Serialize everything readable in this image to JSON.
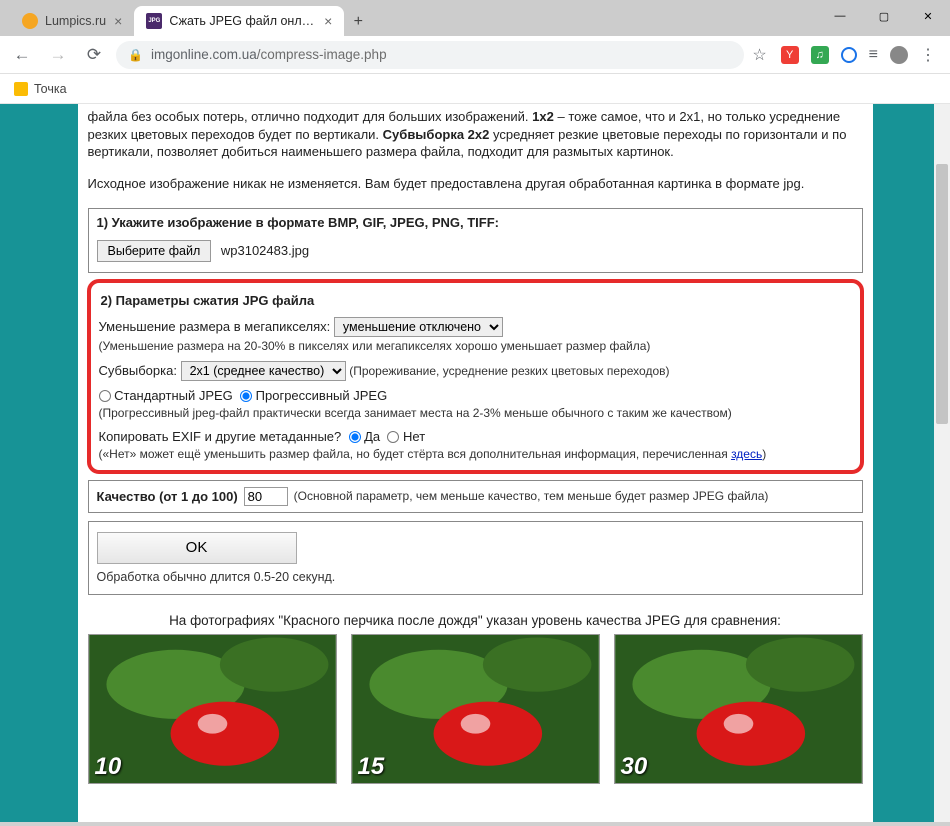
{
  "window": {
    "minimize": "—",
    "maximize": "▢",
    "close": "✕"
  },
  "tabs": {
    "inactive": "Lumpics.ru",
    "active": "Сжать JPEG файл онлайн - IMG",
    "jpgbadge": "JPG"
  },
  "url": {
    "domain": "imgonline.com.ua",
    "path": "/compress-image.php"
  },
  "bookmarks": {
    "folder": "Точка"
  },
  "intro": {
    "p1a": "файла без особых потерь, отлично подходит для больших изображений. ",
    "b1": "1x2",
    "p1b": " – тоже самое, что и 2x1, но только усреднение резких цветовых переходов будет по вертикали. ",
    "b2": "Субвыборка 2x2",
    "p1c": " усредняет резкие цветовые переходы по горизонтали и по вертикали, позволяет добиться наименьшего размера файла, подходит для размытых картинок.",
    "p2": "Исходное изображение никак не изменяется. Вам будет предоставлена другая обработанная картинка в формате jpg."
  },
  "step1": {
    "title": "1) Укажите изображение в формате BMP, GIF, JPEG, PNG, TIFF:",
    "button": "Выберите файл",
    "file": "wp3102483.jpg"
  },
  "step2": {
    "title": "2) Параметры сжатия JPG файла",
    "mp_label": "Уменьшение размера в мегапикселях:",
    "mp_option": "уменьшение отключено",
    "mp_hint": "(Уменьшение размера на 20-30% в пикселях или мегапикселях хорошо уменьшает размер файла)",
    "sub_label": "Субвыборка:",
    "sub_option": "2x1 (среднее качество)",
    "sub_hint": "(Прореживание, усреднение резких цветовых переходов)",
    "jpeg_std": "Стандартный JPEG",
    "jpeg_prog": "Прогрессивный JPEG",
    "jpeg_hint": "(Прогрессивный jpeg-файл практически всегда занимает места на 2-3% меньше обычного с таким же качеством)",
    "exif_label": "Копировать EXIF и другие метаданные?",
    "exif_yes": "Да",
    "exif_no": "Нет",
    "exif_hint_a": "(«Нет» может ещё уменьшить размер файла, но будет стёрта вся дополнительная информация, перечисленная ",
    "exif_link": "здесь",
    "exif_hint_b": ")"
  },
  "quality": {
    "label": "Качество (от 1 до 100)",
    "value": "80",
    "hint": "(Основной параметр, чем меньше качество, тем меньше будет размер JPEG файла)"
  },
  "submit": {
    "button": "OK",
    "hint": "Обработка обычно длится 0.5-20 секунд."
  },
  "compare": {
    "title": "На фотографиях \"Красного перчика после дождя\" указан уровень качества JPEG для сравнения:",
    "q": [
      "10",
      "15",
      "30"
    ]
  }
}
